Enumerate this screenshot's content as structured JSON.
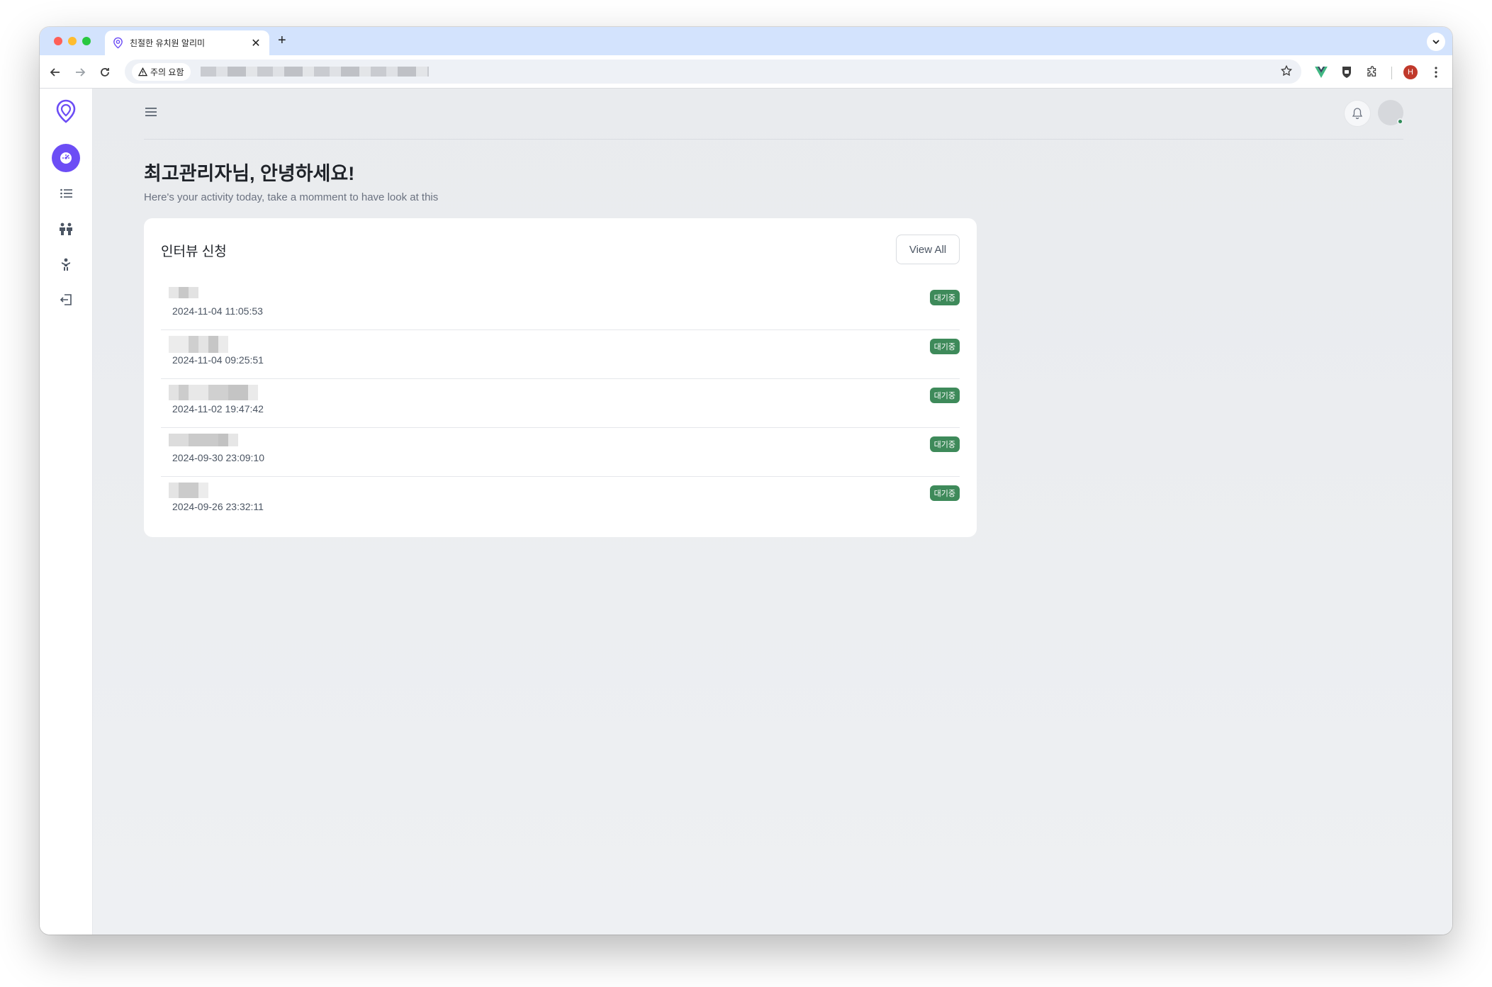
{
  "browser": {
    "tab_title": "친절한 유치원 알리미",
    "new_tab": "+",
    "tab_close": "✕",
    "security_chip": "주의 요함",
    "profile_initial": "H"
  },
  "header": {
    "greeting": "최고관리자님, 안녕하세요!",
    "subtitle": "Here's your activity today, take a momment to have look at this"
  },
  "card": {
    "title": "인터뷰 신청",
    "view_all": "View All",
    "rows": [
      {
        "date": "2024-11-04 11:05:53",
        "status": "대기중"
      },
      {
        "date": "2024-11-04 09:25:51",
        "status": "대기중"
      },
      {
        "date": "2024-11-02 19:47:42",
        "status": "대기중"
      },
      {
        "date": "2024-09-30 23:09:10",
        "status": "대기중"
      },
      {
        "date": "2024-09-26 23:32:11",
        "status": "대기중"
      }
    ]
  },
  "colors": {
    "accent": "#6c4df5",
    "badge": "#3e8a5a",
    "background": "#e9ebee"
  },
  "icons": {
    "sidebar": [
      "location-pin-icon",
      "dashboard-icon",
      "list-icon",
      "people-icon",
      "child-icon",
      "logout-icon"
    ],
    "topbar": [
      "menu-icon",
      "bell-icon",
      "avatar"
    ]
  }
}
